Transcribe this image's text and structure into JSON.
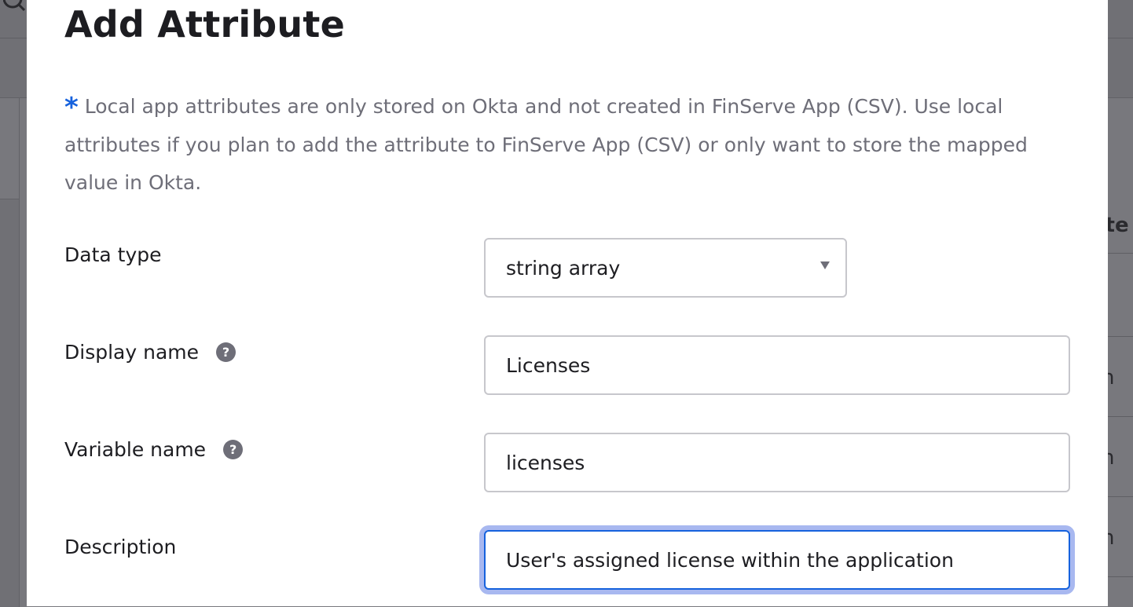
{
  "modal": {
    "title": "Add Attribute",
    "note_star": "*",
    "note_text": "Local app attributes are only stored on Okta and not created in FinServe App (CSV). Use local attributes if you plan to add the attribute to FinServe App (CSV) or only want to store the mapped value in Okta."
  },
  "fields": {
    "data_type": {
      "label": "Data type",
      "value": "string array"
    },
    "display_name": {
      "label": "Display name",
      "value": "Licenses",
      "help": "?"
    },
    "variable_name": {
      "label": "Variable name",
      "value": "licenses",
      "help": "?"
    },
    "description": {
      "label": "Description",
      "value": "User's assigned license within the application"
    }
  },
  "background": {
    "column_header_fragment": "ute",
    "row_fragment": "n"
  },
  "colors": {
    "accent": "#1662dd",
    "focus_ring": "#a8b8f0",
    "text": "#1d1d21",
    "muted_text": "#6e6e78",
    "overlay": "#707075"
  },
  "icons": {
    "search": "search-icon",
    "help": "help-circle-icon",
    "dropdown": "caret-down-icon"
  }
}
